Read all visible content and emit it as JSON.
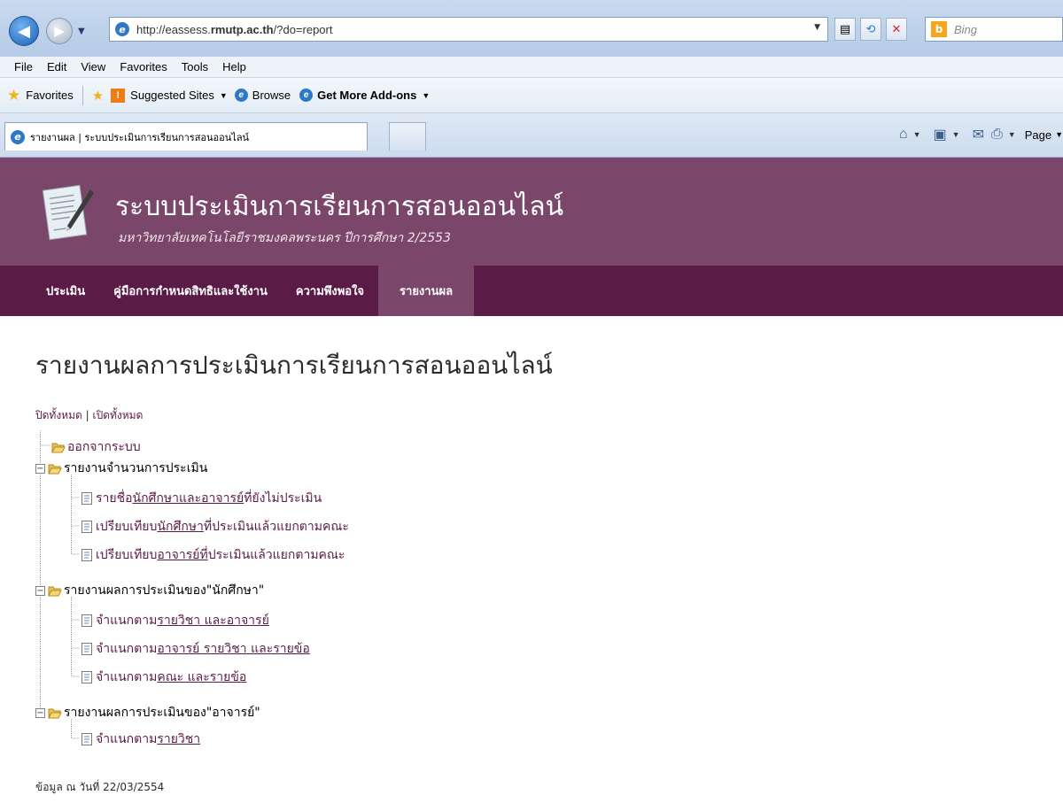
{
  "browser": {
    "url_prefix": "http://eassess.",
    "url_domain": "rmutp.ac.th",
    "url_suffix": "/?do=report",
    "search_placeholder": "Bing",
    "menu": [
      "File",
      "Edit",
      "View",
      "Favorites",
      "Tools",
      "Help"
    ],
    "favorites_label": "Favorites",
    "favorites_links": {
      "suggested": "Suggested Sites",
      "browse": "Browse",
      "addons": "Get More Add-ons"
    },
    "tab_title": "รายงานผล | ระบบประเมินการเรียนการสอนออนไลน์",
    "page_menu": "Page"
  },
  "site": {
    "title": "ระบบประเมินการเรียนการสอนออนไลน์",
    "subtitle": "มหาวิทยาลัยเทคโนโลยีราชมงคลพระนคร ปีการศึกษา 2/2553",
    "nav": [
      "ประเมิน",
      "คู่มือการกำหนดสิทธิและใช้งาน",
      "ความพึงพอใจ",
      "รายงานผล"
    ],
    "active_nav": "รายงานผล"
  },
  "report": {
    "heading": "รายงานผลการประเมินการเรียนการสอนออนไลน์",
    "collapse_all": "ปิดทั้งหมด",
    "separator": " | ",
    "expand_all": "เปิดทั้งหมด",
    "logout": "ออกจากระบบ",
    "groups": [
      {
        "title": "รายงานจำนวนการประเมิน",
        "items": [
          {
            "pre": "รายชื่อ",
            "link": "นักศึกษาและอาจารย์",
            "post": "ที่ยังไม่ประเมิน"
          },
          {
            "pre": "เปรียบเทียบ",
            "link": "นักศึกษา",
            "post": "ที่ประเมินแล้วแยกตามคณะ"
          },
          {
            "pre": "เปรียบเทียบ",
            "link": "อาจารย์ที่",
            "post": "ประเมินแล้วแยกตามคณะ"
          }
        ]
      },
      {
        "title": "รายงานผลการประเมินของ\"นักศึกษา\"",
        "items": [
          {
            "pre": "จำแนกตาม",
            "link": "รายวิชา และอาจารย์",
            "post": ""
          },
          {
            "pre": "จำแนกตาม",
            "link": "อาจารย์ รายวิชา และรายข้อ",
            "post": ""
          },
          {
            "pre": "จำแนกตาม",
            "link": "คณะ และรายข้อ",
            "post": ""
          }
        ]
      },
      {
        "title": "รายงานผลการประเมินของ\"อาจารย์\"",
        "items": [
          {
            "pre": "จำแนกตาม",
            "link": "รายวิชา",
            "post": ""
          }
        ]
      }
    ],
    "data_date": "ข้อมูล ณ วันที่ 22/03/2554"
  }
}
